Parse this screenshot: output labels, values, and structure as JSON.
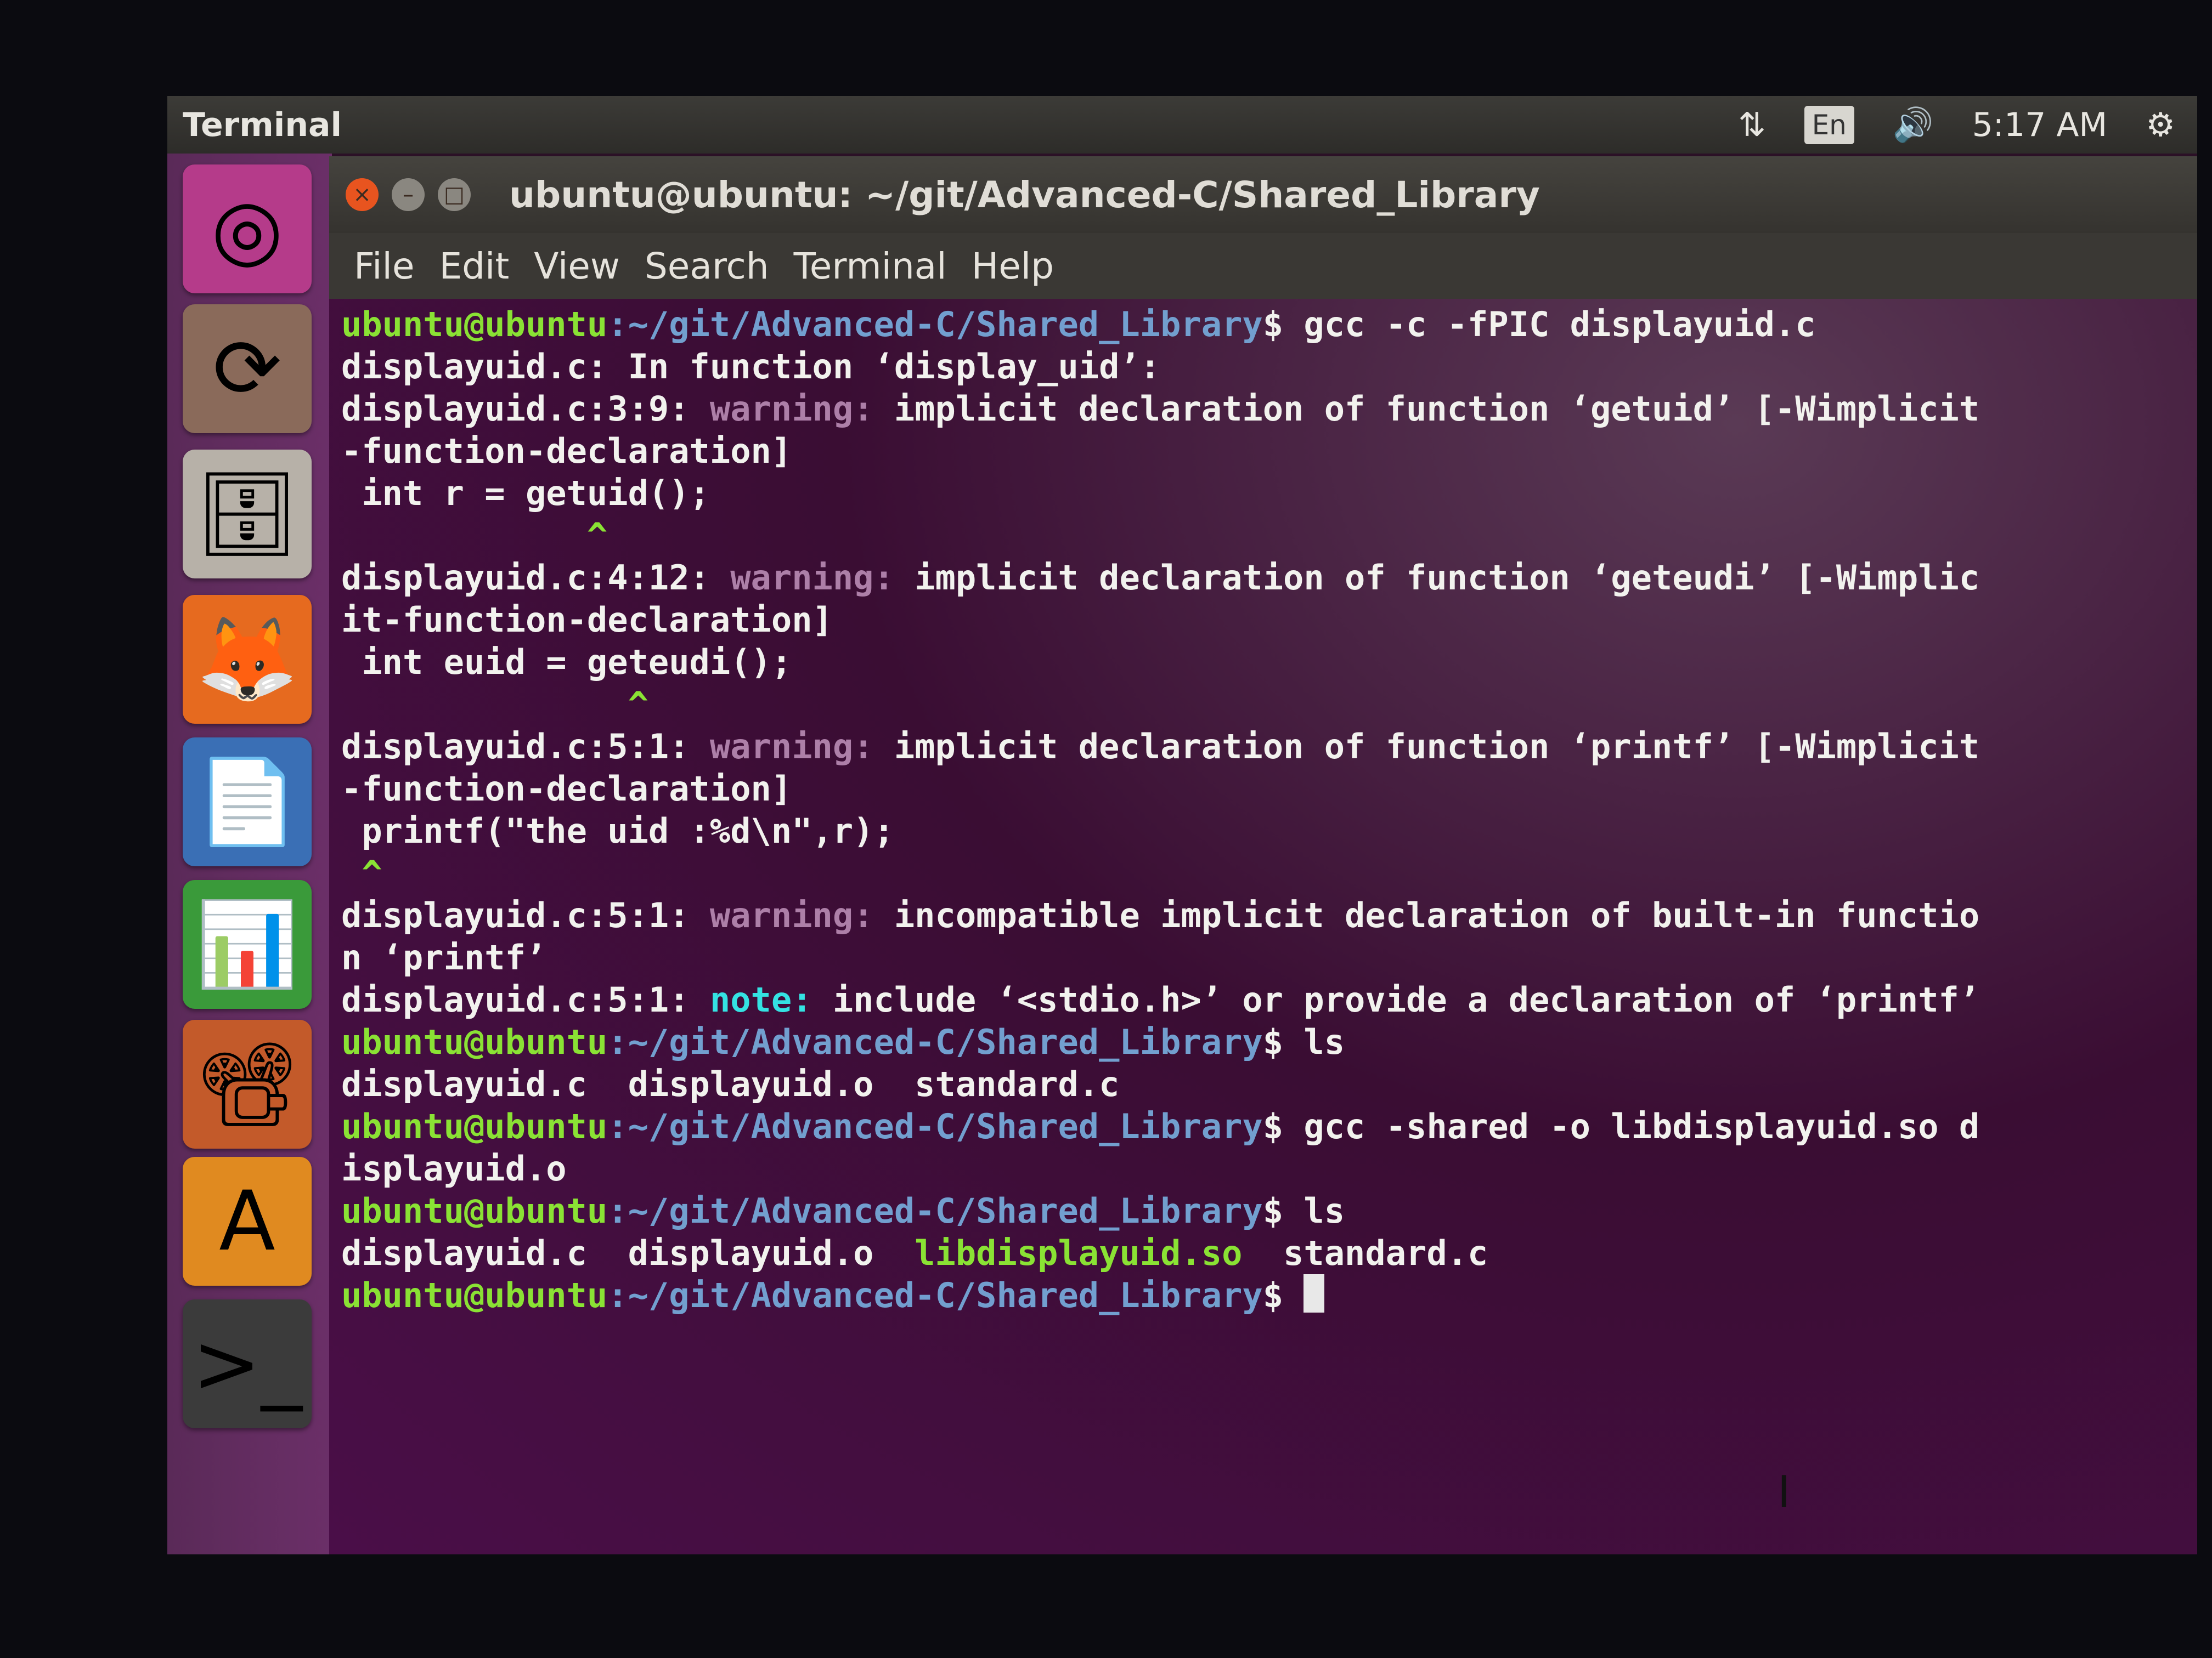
{
  "topbar": {
    "title": "Terminal",
    "network_icon": "⇅",
    "keyboard": "En",
    "volume_icon": "🔊",
    "time": "5:17 AM",
    "settings_icon": "⚙"
  },
  "launcher": {
    "items": [
      {
        "name": "Dash",
        "glyph": "◎",
        "color": "#b53b8a"
      },
      {
        "name": "Software Updater",
        "glyph": "⟳",
        "color": "#8a6a5a"
      },
      {
        "name": "Files",
        "glyph": "🗄",
        "color": "#b7b1a8"
      },
      {
        "name": "Firefox",
        "glyph": "🦊",
        "color": "#e66a1f"
      },
      {
        "name": "LibreOffice Writer",
        "glyph": "📄",
        "color": "#3a6fb5"
      },
      {
        "name": "LibreOffice Calc",
        "glyph": "📊",
        "color": "#3a9a3a"
      },
      {
        "name": "LibreOffice Impress",
        "glyph": "📽",
        "color": "#c35a2a"
      },
      {
        "name": "Ubuntu Software",
        "glyph": "A",
        "color": "#e08a20"
      },
      {
        "name": "Terminal",
        "glyph": ">_",
        "color": "#3b3b3b"
      }
    ]
  },
  "window": {
    "title": "ubuntu@ubuntu: ~/git/Advanced-C/Shared_Library",
    "close": "×",
    "minimize": "–",
    "maximize": "□"
  },
  "menu": [
    "File",
    "Edit",
    "View",
    "Search",
    "Terminal",
    "Help"
  ],
  "prompt": {
    "user": "ubuntu@ubuntu",
    "path": ":~/git/Advanced-C/Shared_Library",
    "symbol": "$"
  },
  "lines": {
    "cmd1": " gcc -c -fPIC displayuid.c",
    "l2": "displayuid.c: In function ‘display_uid’:",
    "l3a": "displayuid.c:3:9: ",
    "warn": "warning:",
    "note": "note:",
    "l3b": " implicit declaration of function ‘getuid’ [-Wimplicit",
    "l4": "-function-declaration]",
    "l5": " int r = getuid();",
    "caret1": "            ^",
    "l7a": "displayuid.c:4:12: ",
    "l7b": " implicit declaration of function ‘geteudi’ [-Wimplic",
    "l8": "it-function-declaration]",
    "l9": " int euid = geteudi();",
    "caret2": "              ^",
    "l11a": "displayuid.c:5:1: ",
    "l11b": " implicit declaration of function ‘printf’ [-Wimplicit",
    "l12": "-function-declaration]",
    "l13": " printf(\"the uid :%d\\n\",r);",
    "caret3": " ^",
    "l15a": "displayuid.c:5:1: ",
    "l15b": " incompatible implicit declaration of built-in functio",
    "l16": "n ‘printf’",
    "l17a": "displayuid.c:5:1: ",
    "l17b": " include ‘<stdio.h>’ or provide a declaration of ‘printf’",
    "cmd2": " ls",
    "ls1": "displayuid.c  displayuid.o  standard.c",
    "cmd3": " gcc -shared -o libdisplayuid.so d",
    "cmd3b": "isplayuid.o",
    "cmd4": " ls",
    "ls2a": "displayuid.c  displayuid.o  ",
    "ls2lib": "libdisplayuid.so",
    "ls2b": "  standard.c"
  }
}
